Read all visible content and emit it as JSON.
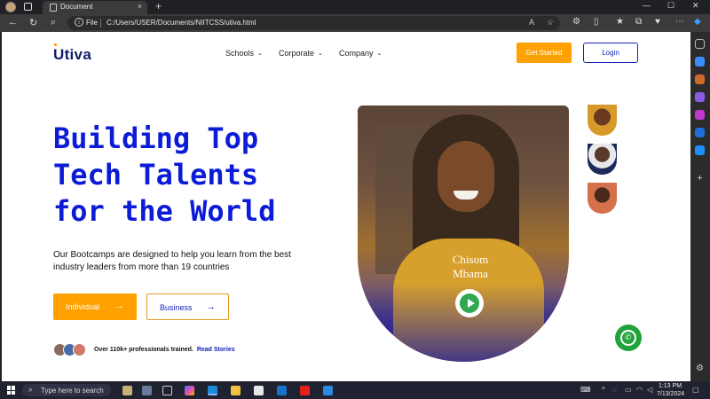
{
  "browser": {
    "tab_title": "Document",
    "tab_close": "×",
    "new_tab": "+",
    "file_label": "File",
    "url": "C:/Users/USER/Documents/NIITCSS/utiva.html",
    "win_min": "—",
    "win_max": "☐",
    "win_close": "✕"
  },
  "nav": {
    "logo": "Utiva",
    "menu": [
      {
        "label": "Schools",
        "chev": "⌄"
      },
      {
        "label": "Corporate",
        "chev": "⌄"
      },
      {
        "label": "Company",
        "chev": "⌄"
      }
    ],
    "get_started": "Get Started",
    "login": "Login"
  },
  "hero": {
    "title_line1": "Building Top",
    "title_line2": "Tech Talents",
    "title_line3": "for the World",
    "subtitle": "Our Bootcamps are designed to help you learn from the best industry leaders from more than 19 countries",
    "individual": "Individual",
    "business": "Business",
    "arrow": "→",
    "proof_text": "Over 110k+ professionals trained.",
    "proof_link": "Read Stories"
  },
  "video": {
    "name_line1": "Chisom",
    "name_line2": "Mbama"
  },
  "taskbar": {
    "search_placeholder": "Type here to search",
    "time": "1:13 PM",
    "date": "7/13/2024"
  },
  "colors": {
    "brand_blue": "#0b1bd6",
    "accent_orange": "#ffa100",
    "whatsapp_green": "#1fa33a"
  }
}
